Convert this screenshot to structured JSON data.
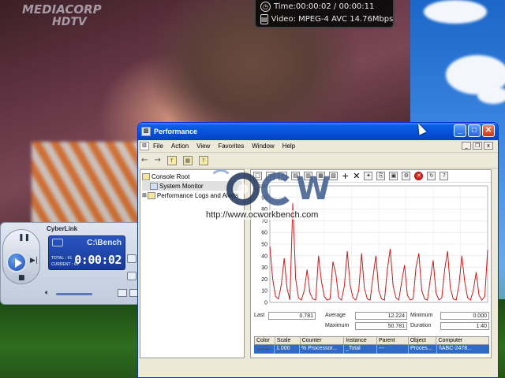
{
  "video": {
    "channel_line1": "MEDIACORP",
    "channel_line2": "HDTV",
    "osd_time": "Time:00:00:02 / 00:00:11",
    "osd_video": "Video: MPEG-4 AVC 14.76Mbps"
  },
  "player": {
    "brand": "CyberLink",
    "path": "C:\\Bench",
    "time": "0:00:02",
    "total_label": "TOTAL",
    "total_value": "01",
    "current_label": "CURRENT",
    "current_value": "01"
  },
  "window": {
    "title": "Performance",
    "menu": [
      "File",
      "Action",
      "View",
      "Favorites",
      "Window",
      "Help"
    ],
    "tree": {
      "root": "Console Root",
      "items": [
        "System Monitor",
        "Performance Logs and Alerts"
      ]
    },
    "stats": {
      "last_label": "Last",
      "last_value": "0.781",
      "average_label": "Average",
      "average_value": "12.224",
      "minimum_label": "Minimum",
      "minimum_value": "0.000",
      "maximum_label": "Maximum",
      "maximum_value": "50.781",
      "duration_label": "Duration",
      "duration_value": "1:40"
    },
    "legend": {
      "headers": [
        "Color",
        "Scale",
        "Counter",
        "Instance",
        "Parent",
        "Object",
        "Computer"
      ],
      "row": [
        "",
        "1.000",
        "% Processor...",
        "_Total",
        "---",
        "Proces...",
        "\\\\ABC-2478..."
      ]
    }
  },
  "watermark": {
    "url": "http://www.ocworkbench.com"
  },
  "chart_data": {
    "type": "line",
    "ylim": [
      0,
      100
    ],
    "yticks": [
      "100",
      "90",
      "80",
      "70",
      "60",
      "50",
      "40",
      "30",
      "20",
      "10",
      "0"
    ],
    "series": [
      {
        "color": "#d01818",
        "values": [
          48,
          20,
          5,
          3,
          15,
          38,
          12,
          2,
          85,
          20,
          4,
          2,
          10,
          28,
          8,
          3,
          2,
          40,
          18,
          5,
          2,
          3,
          35,
          25,
          4,
          2,
          14,
          44,
          15,
          4,
          2,
          10,
          42,
          12,
          3,
          2,
          22,
          40,
          10,
          3,
          2,
          28,
          46,
          14,
          4,
          2,
          18,
          32,
          6,
          2,
          3,
          30,
          42,
          10,
          3,
          2,
          20,
          36,
          8,
          2,
          4,
          28,
          44,
          12,
          3,
          2,
          15,
          40,
          18,
          4,
          2,
          10,
          26,
          6,
          2,
          5,
          45
        ]
      }
    ]
  }
}
